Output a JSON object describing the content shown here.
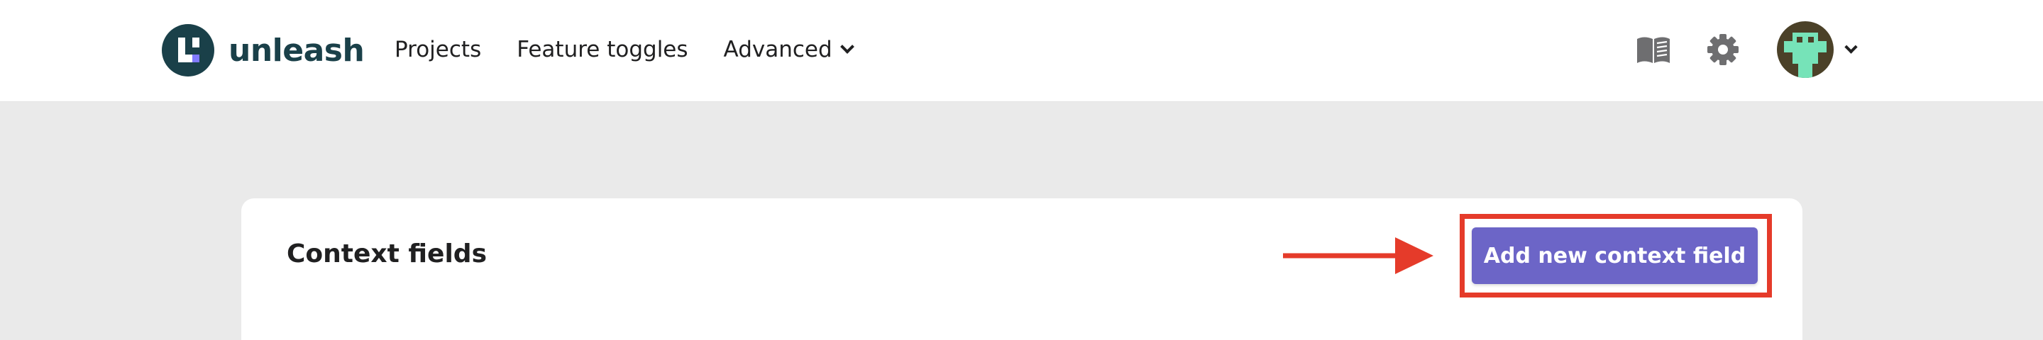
{
  "header": {
    "logo_text": "unleash",
    "nav": {
      "projects": "Projects",
      "feature_toggles": "Feature toggles",
      "advanced": "Advanced"
    },
    "icons": {
      "docs": "book-icon",
      "settings": "gear-icon",
      "avatar": "user-avatar",
      "avatar_menu": "chevron-down-icon"
    }
  },
  "main": {
    "card_title": "Context fields",
    "add_button_label": "Add new context field"
  },
  "colors": {
    "brand_dark": "#1a4049",
    "brand_accent": "#817afe",
    "primary_button": "#6c65c7",
    "annotation_red": "#e53b2a",
    "page_background": "#eaeaea"
  }
}
